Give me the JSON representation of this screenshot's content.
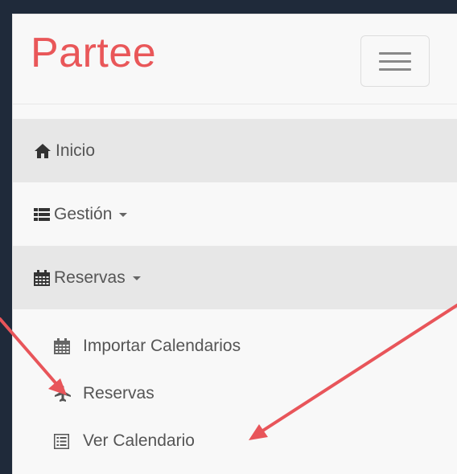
{
  "brand": {
    "name": "Partee",
    "color": "#e95759"
  },
  "navbar": {
    "toggle_icon": "hamburger-icon"
  },
  "nav": {
    "items": [
      {
        "label": "Inicio",
        "icon": "home-icon",
        "active": true
      },
      {
        "label": "Gestión",
        "icon": "th-list-icon",
        "dropdown": true
      },
      {
        "label": "Reservas",
        "icon": "calendar-icon",
        "dropdown": true,
        "active": true
      }
    ],
    "reservas_submenu": [
      {
        "label": "Importar Calendarios",
        "icon": "calendar-icon"
      },
      {
        "label": "Reservas",
        "icon": "plane-icon"
      },
      {
        "label": "Ver Calendario",
        "icon": "list-alt-icon"
      }
    ]
  },
  "annotations": {
    "arrow_color": "#e8555a"
  }
}
